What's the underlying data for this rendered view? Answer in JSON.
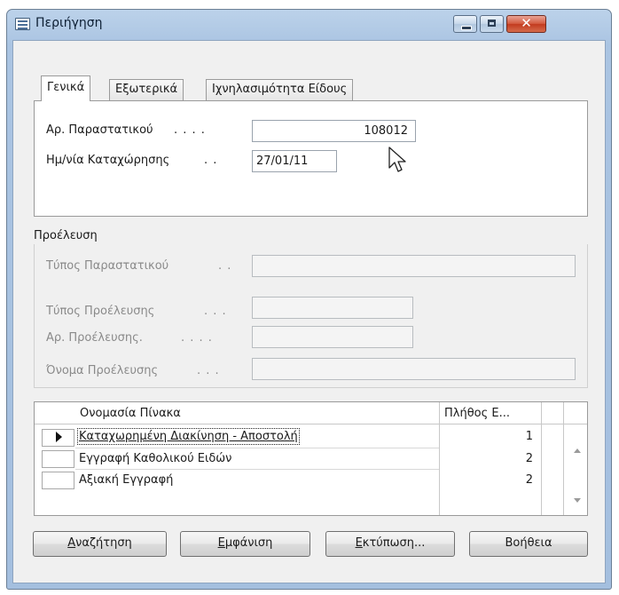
{
  "window": {
    "title": "Περιήγηση",
    "close_symbol": "✕"
  },
  "tabs": [
    {
      "label": "Γενικά",
      "active": true
    },
    {
      "label": "Εξωτερικά",
      "active": false
    },
    {
      "label": "Ιχνηλασιμότητα Είδους",
      "active": false
    }
  ],
  "general": {
    "doc_no": {
      "label": "Αρ. Παραστατικού",
      "dots": ". . . .",
      "value": "108012"
    },
    "posting_date": {
      "label": "Ημ/νία Καταχώρησης",
      "dots": ". .",
      "value": "27/01/11"
    }
  },
  "source": {
    "group_label": "Προέλευση",
    "fields": [
      {
        "label": "Τύπος Παραστατικού",
        "dots": ". .",
        "value": ""
      },
      {
        "label": "Τύπος Προέλευσης",
        "dots": ". . .",
        "value": ""
      },
      {
        "label": "Αρ. Προέλευσης.",
        "dots": ". . . .",
        "value": ""
      },
      {
        "label": "Όνομα Προέλευσης",
        "dots": ". . .",
        "value": ""
      }
    ]
  },
  "table": {
    "columns": [
      "Ονομασία Πίνακα",
      "Πλήθος Ε..."
    ],
    "rows": [
      {
        "name": "Καταχωρημένη Διακίνηση - Αποστολή",
        "count": "1",
        "selected": true
      },
      {
        "name": "Εγγραφή Καθολικού Ειδών",
        "count": "2",
        "selected": false
      },
      {
        "name": "Αξιακή Εγγραφή",
        "count": "2",
        "selected": false
      }
    ]
  },
  "buttons": {
    "search": {
      "mnemonic": "Α",
      "rest": "ναζήτηση"
    },
    "show": {
      "mnemonic": "Ε",
      "rest": "μφάνιση"
    },
    "print": {
      "mnemonic": "Ε",
      "rest": "κτύπωση..."
    },
    "help": {
      "label": "Βοήθεια"
    }
  },
  "icons": {
    "window_icon": "table-icon",
    "minimize": "minimize-icon",
    "maximize": "maximize-icon",
    "close": "close-icon",
    "cursor": "mouse-pointer-icon"
  }
}
